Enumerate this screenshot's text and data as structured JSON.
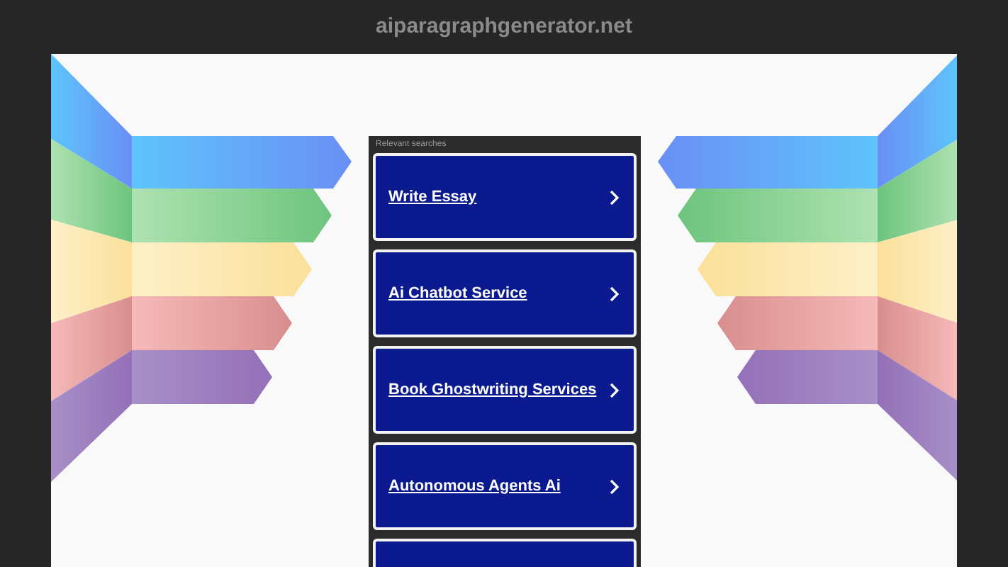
{
  "domain": "aiparagraphgenerator.net",
  "section_title": "Relevant searches",
  "links": [
    {
      "label": "Write Essay"
    },
    {
      "label": "Ai Chatbot Service"
    },
    {
      "label": "Book Ghostwriting Services"
    },
    {
      "label": "Autonomous Agents Ai"
    }
  ]
}
